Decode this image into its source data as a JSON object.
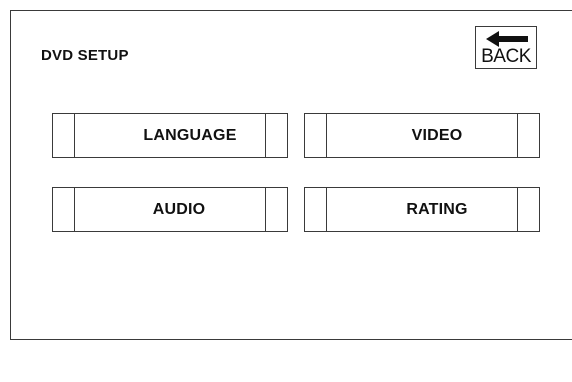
{
  "header": {
    "title": "DVD SETUP",
    "back_label": "BACK",
    "back_icon": "arrow-left-icon"
  },
  "menu": {
    "items": [
      {
        "label": "LANGUAGE"
      },
      {
        "label": "VIDEO"
      },
      {
        "label": "AUDIO"
      },
      {
        "label": "RATING"
      }
    ]
  }
}
